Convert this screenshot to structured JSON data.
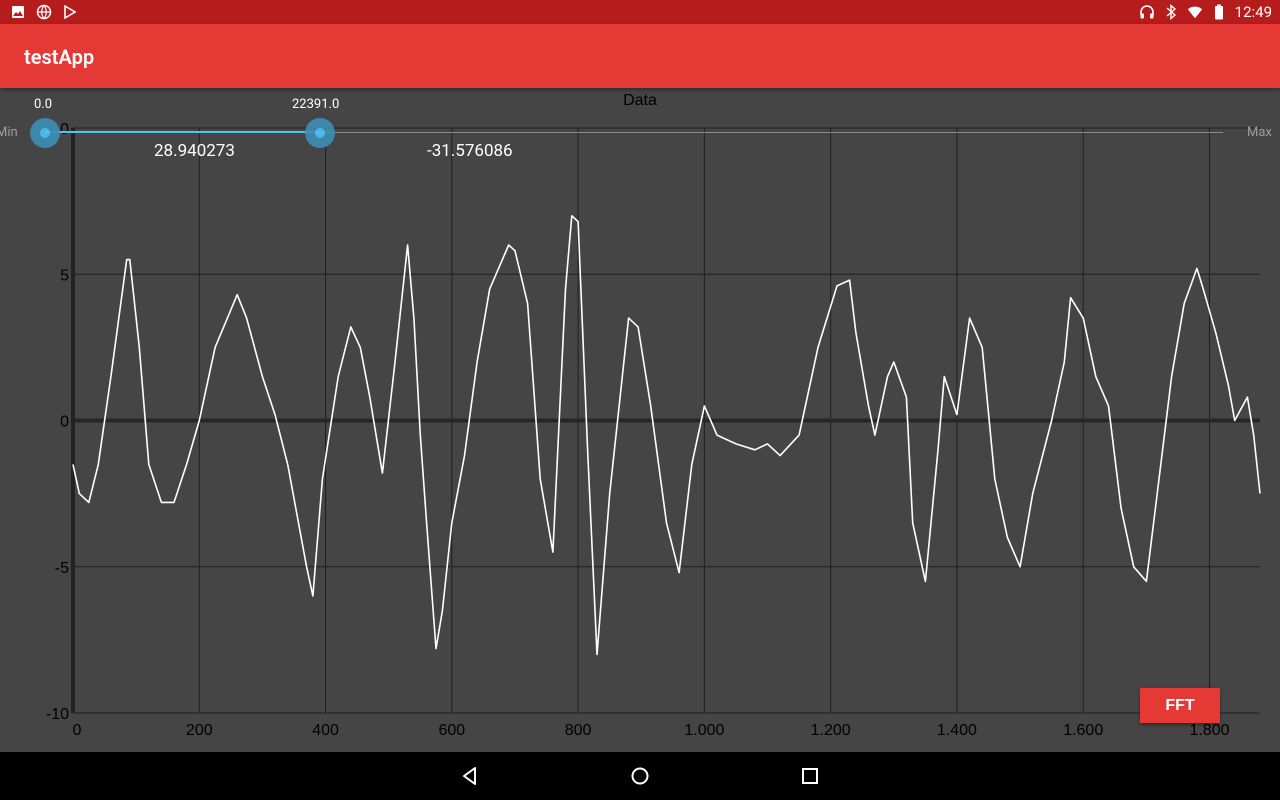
{
  "status_bar": {
    "time": "12:49",
    "left_icons": [
      "image-icon",
      "globe-icon",
      "play-store-icon"
    ],
    "right_icons": [
      "headphones-icon",
      "bluetooth-icon",
      "wifi-icon",
      "battery-icon"
    ]
  },
  "app_bar": {
    "title": "testApp"
  },
  "range_slider": {
    "min_label": "Min",
    "max_label": "Max",
    "low_value_label": "0.0",
    "high_value_label": "22391.0",
    "low_readout": "28.940273",
    "high_readout": "-31.576086"
  },
  "fft_button": {
    "label": "FFT"
  },
  "nav_bar": {
    "buttons": [
      "back-icon",
      "home-icon",
      "recents-icon"
    ]
  },
  "colors": {
    "status_bar": "#b71c1c",
    "app_bar": "#e53935",
    "chart_bg": "#454545",
    "slider_accent": "#4fc3f7"
  },
  "chart_data": {
    "type": "line",
    "title": "Data",
    "xlabel": "",
    "ylabel": "",
    "xlim": [
      0,
      1880
    ],
    "ylim": [
      -10,
      10
    ],
    "x_ticks": [
      0,
      200,
      400,
      600,
      800,
      1000,
      1200,
      1400,
      1600,
      1800
    ],
    "x_tick_labels": [
      "0",
      "200",
      "400",
      "600",
      "800",
      "1.000",
      "1.200",
      "1.400",
      "1.600",
      "1.800"
    ],
    "y_ticks": [
      -10,
      -5,
      0,
      5,
      10
    ],
    "y_tick_labels": [
      "-10",
      "-5",
      "0",
      "5",
      "0"
    ],
    "grid": true,
    "series": [
      {
        "color": "#ffffff",
        "x": [
          0,
          10,
          25,
          40,
          60,
          85,
          90,
          105,
          120,
          140,
          160,
          180,
          200,
          225,
          260,
          275,
          300,
          320,
          340,
          370,
          380,
          395,
          420,
          440,
          455,
          470,
          490,
          510,
          530,
          540,
          550,
          560,
          575,
          585,
          600,
          620,
          640,
          660,
          690,
          700,
          720,
          740,
          760,
          780,
          790,
          800,
          815,
          830,
          850,
          880,
          895,
          915,
          940,
          960,
          980,
          1000,
          1020,
          1050,
          1080,
          1100,
          1120,
          1150,
          1180,
          1210,
          1230,
          1240,
          1260,
          1270,
          1290,
          1300,
          1320,
          1330,
          1350,
          1370,
          1380,
          1400,
          1420,
          1440,
          1460,
          1480,
          1500,
          1520,
          1550,
          1570,
          1580,
          1600,
          1620,
          1640,
          1660,
          1680,
          1700,
          1720,
          1740,
          1760,
          1780,
          1790,
          1810,
          1830,
          1840,
          1860,
          1870,
          1880
        ],
        "y": [
          -1.5,
          -2.5,
          -2.8,
          -1.5,
          1.5,
          5.5,
          5.5,
          2.5,
          -1.5,
          -2.8,
          -2.8,
          -1.5,
          0,
          2.5,
          4.3,
          3.5,
          1.5,
          0.2,
          -1.5,
          -5,
          -6,
          -2,
          1.5,
          3.2,
          2.5,
          0.8,
          -1.8,
          2,
          6,
          3.5,
          -0.5,
          -3.5,
          -7.8,
          -6.5,
          -3.5,
          -1.2,
          2,
          4.5,
          6,
          5.8,
          4,
          -2,
          -4.5,
          4.5,
          7,
          6.8,
          -1,
          -8,
          -2.5,
          3.5,
          3.2,
          0.5,
          -3.5,
          -5.2,
          -1.5,
          0.5,
          -0.5,
          -0.8,
          -1,
          -0.8,
          -1.2,
          -0.5,
          2.5,
          4.6,
          4.8,
          3,
          0.5,
          -0.5,
          1.5,
          2,
          0.8,
          -3.5,
          -5.5,
          -1,
          1.5,
          0.2,
          3.5,
          2.5,
          -2,
          -4,
          -5,
          -2.5,
          0,
          2,
          4.2,
          3.5,
          1.5,
          0.5,
          -3,
          -5,
          -5.5,
          -2,
          1.5,
          4,
          5.2,
          4.5,
          3,
          1.2,
          0,
          0.8,
          -0.5,
          -2.5
        ]
      }
    ]
  }
}
